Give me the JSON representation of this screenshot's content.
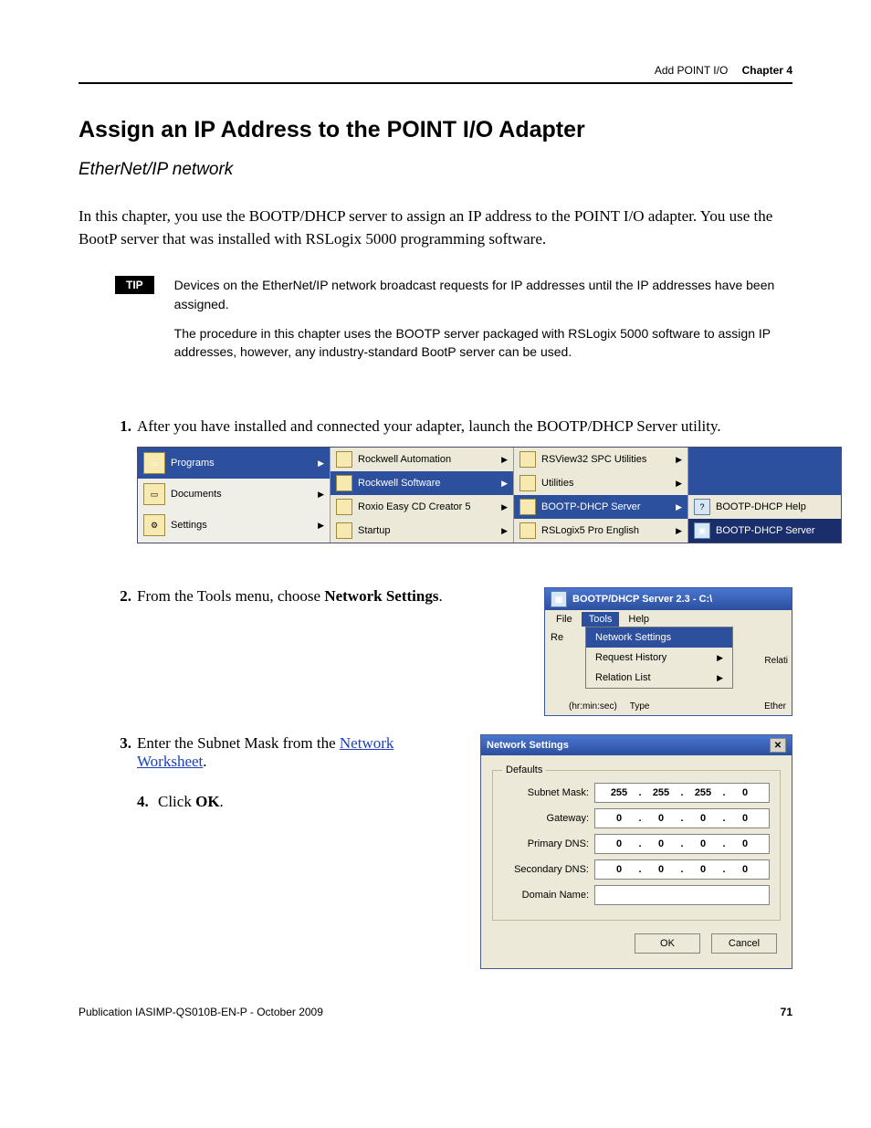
{
  "header": {
    "left": "Add POINT I/O",
    "chapter": "Chapter 4"
  },
  "title": "Assign an IP Address to the POINT I/O Adapter",
  "subtitle": "EtherNet/IP network",
  "intro": "In this chapter, you use the BOOTP/DHCP server to assign an IP address to the POINT I/O adapter. You use the BootP server that was installed with RSLogix 5000 programming software.",
  "tip": {
    "label": "TIP",
    "p1": "Devices on the EtherNet/IP network broadcast requests for IP addresses until the IP addresses have been assigned.",
    "p2": "The procedure in this chapter uses the BOOTP server packaged with RSLogix 5000 software to assign IP addresses, however, any industry-standard BootP server can be used."
  },
  "step1": "After you have installed and connected your adapter, launch the BOOTP/DHCP Server utility.",
  "step2_prefix": "From the Tools menu, choose ",
  "step2_bold": "Network Settings",
  "step3_prefix": "Enter the Subnet Mask from the ",
  "step3_link": "Network Worksheet",
  "step4_prefix": "Click ",
  "step4_bold": "OK",
  "startmenu": {
    "col1": [
      "Programs",
      "Documents",
      "Settings"
    ],
    "col2_top": "Rockwell Automation",
    "col2_sel": "Rockwell Software",
    "col2_a": "Roxio Easy CD Creator 5",
    "col2_b": "Startup",
    "col3": [
      "RSView32 SPC Utilities",
      "Utilities",
      "BOOTP-DHCP Server",
      "RSLogix5 Pro English"
    ],
    "col4": [
      "BOOTP-DHCP Help",
      "BOOTP-DHCP Server"
    ]
  },
  "toolsmenu": {
    "title": "BOOTP/DHCP Server 2.3 - C:\\",
    "menubar": [
      "File",
      "Tools",
      "Help"
    ],
    "items": [
      "Network Settings",
      "Request History",
      "Relation List"
    ],
    "re": "Re",
    "relati": "Relati",
    "cols": [
      "(hr:min:sec)",
      "Type",
      "Ether"
    ]
  },
  "netdlg": {
    "title": "Network Settings",
    "legend": "Defaults",
    "fields": {
      "subnet": {
        "label": "Subnet Mask:",
        "octets": [
          "255",
          "255",
          "255",
          "0"
        ]
      },
      "gateway": {
        "label": "Gateway:",
        "octets": [
          "0",
          "0",
          "0",
          "0"
        ]
      },
      "pdns": {
        "label": "Primary DNS:",
        "octets": [
          "0",
          "0",
          "0",
          "0"
        ]
      },
      "sdns": {
        "label": "Secondary DNS:",
        "octets": [
          "0",
          "0",
          "0",
          "0"
        ]
      },
      "domain": {
        "label": "Domain Name:"
      }
    },
    "ok": "OK",
    "cancel": "Cancel"
  },
  "footer": {
    "pub": "Publication IASIMP-QS010B-EN-P - October 2009",
    "page": "71"
  }
}
